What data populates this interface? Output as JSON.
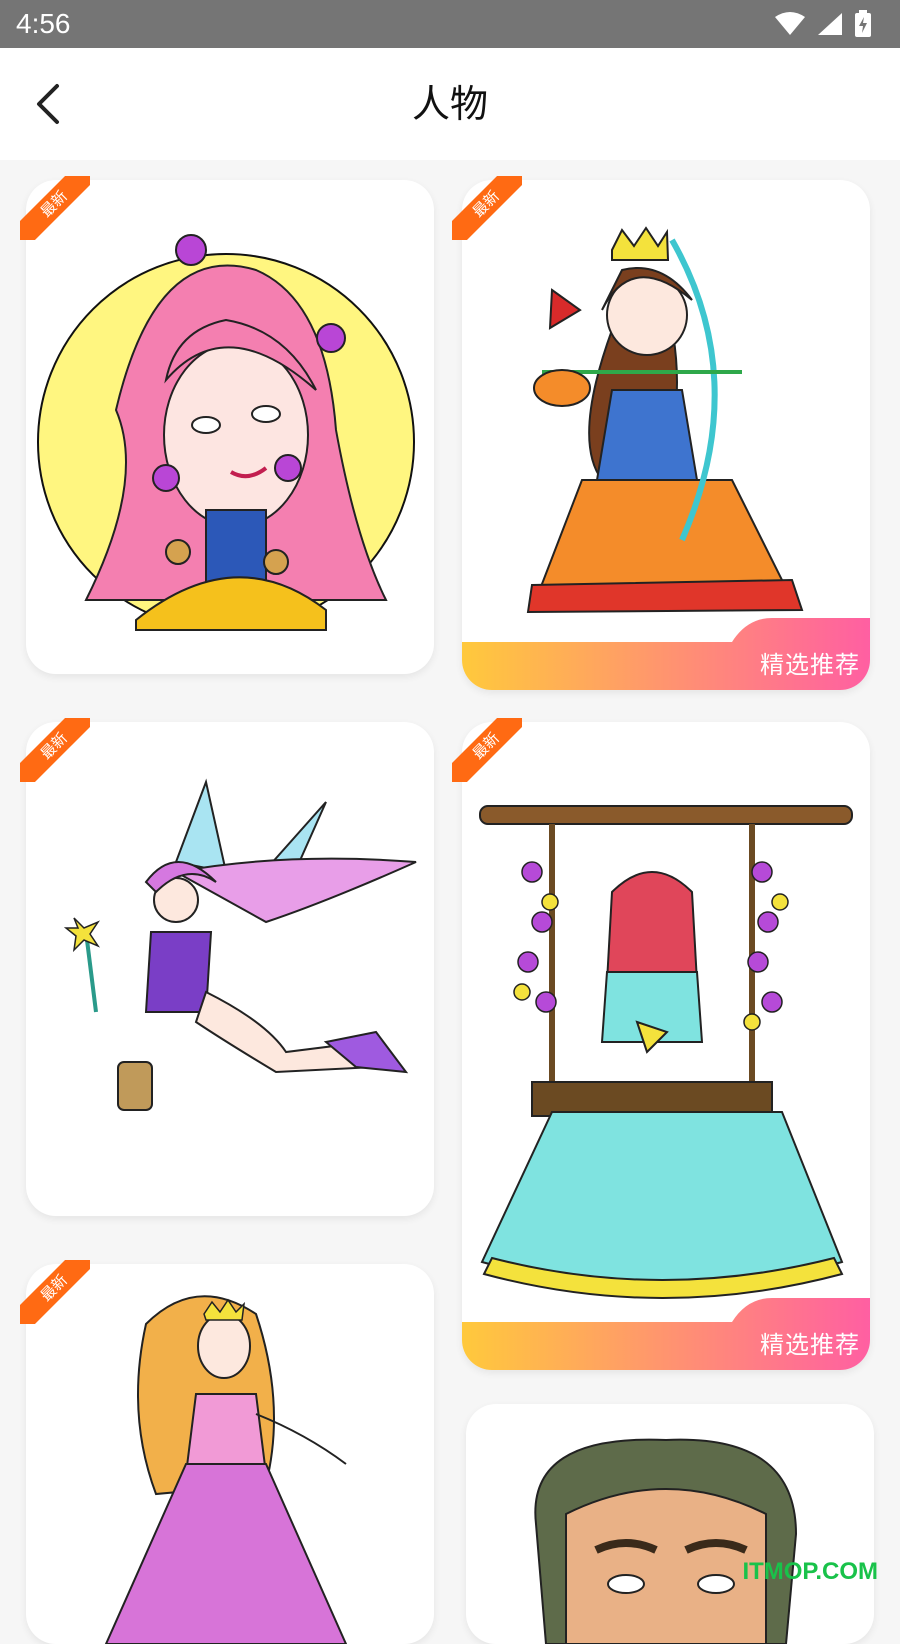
{
  "status_bar": {
    "time": "4:56"
  },
  "header": {
    "title": "人物"
  },
  "badges": {
    "new_label": "最新",
    "featured_label": "精选推荐"
  },
  "colors": {
    "ribbon": "#ff6a13",
    "featured_start": "#ffc93c",
    "featured_end": "#ff5fa2",
    "accent_green": "#19c24a"
  },
  "icons": {
    "back": "chevron-left-icon",
    "wifi": "wifi-icon",
    "signal": "signal-icon",
    "battery": "battery-charging-icon"
  },
  "cards": [
    {
      "subject": "pink-haired-girl",
      "badge": "最新"
    },
    {
      "subject": "archer-princess",
      "badge": "最新",
      "featured": "精选推荐"
    },
    {
      "subject": "fairy",
      "badge": "最新"
    },
    {
      "subject": "girl-on-swing",
      "badge": "最新",
      "featured": "精选推荐"
    },
    {
      "subject": "princess-pink-dress",
      "badge": "最新"
    },
    {
      "subject": "man-portrait"
    }
  ],
  "watermark": "ITMOP.COM"
}
